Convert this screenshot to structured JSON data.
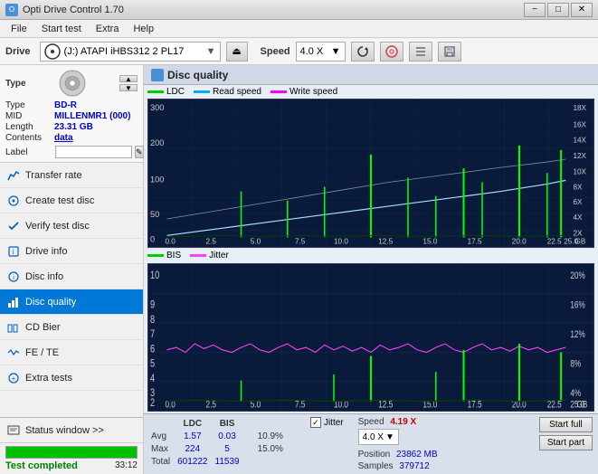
{
  "titlebar": {
    "title": "Opti Drive Control 1.70",
    "min_btn": "−",
    "max_btn": "□",
    "close_btn": "✕"
  },
  "menubar": {
    "items": [
      "File",
      "Start test",
      "Extra",
      "Help"
    ]
  },
  "drivebar": {
    "drive_label": "Drive",
    "drive_value": "(J:)  ATAPI iHBS312  2 PL17",
    "speed_label": "Speed",
    "speed_value": "4.0 X"
  },
  "sidebar": {
    "disc_section": {
      "type_label": "Type",
      "type_value": "BD-R",
      "mid_label": "MID",
      "mid_value": "MILLENMR1 (000)",
      "length_label": "Length",
      "length_value": "23.31 GB",
      "contents_label": "Contents",
      "contents_value": "data",
      "label_label": "Label"
    },
    "nav_items": [
      {
        "id": "transfer-rate",
        "label": "Transfer rate",
        "icon": "chart"
      },
      {
        "id": "create-test-disc",
        "label": "Create test disc",
        "icon": "disc"
      },
      {
        "id": "verify-test-disc",
        "label": "Verify test disc",
        "icon": "check"
      },
      {
        "id": "drive-info",
        "label": "Drive info",
        "icon": "info"
      },
      {
        "id": "disc-info",
        "label": "Disc info",
        "icon": "disc-info"
      },
      {
        "id": "disc-quality",
        "label": "Disc quality",
        "icon": "quality",
        "active": true
      },
      {
        "id": "cd-bier",
        "label": "CD Bier",
        "icon": "cd"
      },
      {
        "id": "fe-te",
        "label": "FE / TE",
        "icon": "fe"
      },
      {
        "id": "extra-tests",
        "label": "Extra tests",
        "icon": "extra"
      }
    ],
    "status_window": "Status window >>",
    "progress": {
      "percent": 100,
      "status_text": "Test completed",
      "time": "33:12"
    }
  },
  "chart": {
    "title": "Disc quality",
    "legend": {
      "ldc_label": "LDC",
      "read_speed_label": "Read speed",
      "write_speed_label": "Write speed"
    },
    "legend2": {
      "bis_label": "BIS",
      "jitter_label": "Jitter"
    },
    "x_axis_max": "25.0",
    "x_axis_unit": "GB",
    "top_chart": {
      "y_left_max": 300,
      "y_right_labels": [
        "18X",
        "16X",
        "14X",
        "12X",
        "10X",
        "8X",
        "6X",
        "4X",
        "2X"
      ]
    },
    "bottom_chart": {
      "y_left_max": 10,
      "y_right_labels": [
        "20%",
        "16%",
        "12%",
        "8%",
        "4%"
      ]
    }
  },
  "stats": {
    "col_ldc": "LDC",
    "col_bis": "BIS",
    "col_jitter": "Jitter",
    "col_speed": "Speed",
    "col_position": "Position",
    "col_samples": "Samples",
    "avg_label": "Avg",
    "max_label": "Max",
    "total_label": "Total",
    "avg_ldc": "1.57",
    "avg_bis": "0.03",
    "avg_jitter": "10.9%",
    "max_ldc": "224",
    "max_bis": "5",
    "max_jitter": "15.0%",
    "total_ldc": "601222",
    "total_bis": "11539",
    "speed_val": "4.19 X",
    "speed_select": "4.0 X",
    "position_val": "23862 MB",
    "samples_val": "379712",
    "start_full_label": "Start full",
    "start_part_label": "Start part",
    "jitter_checked": true
  }
}
